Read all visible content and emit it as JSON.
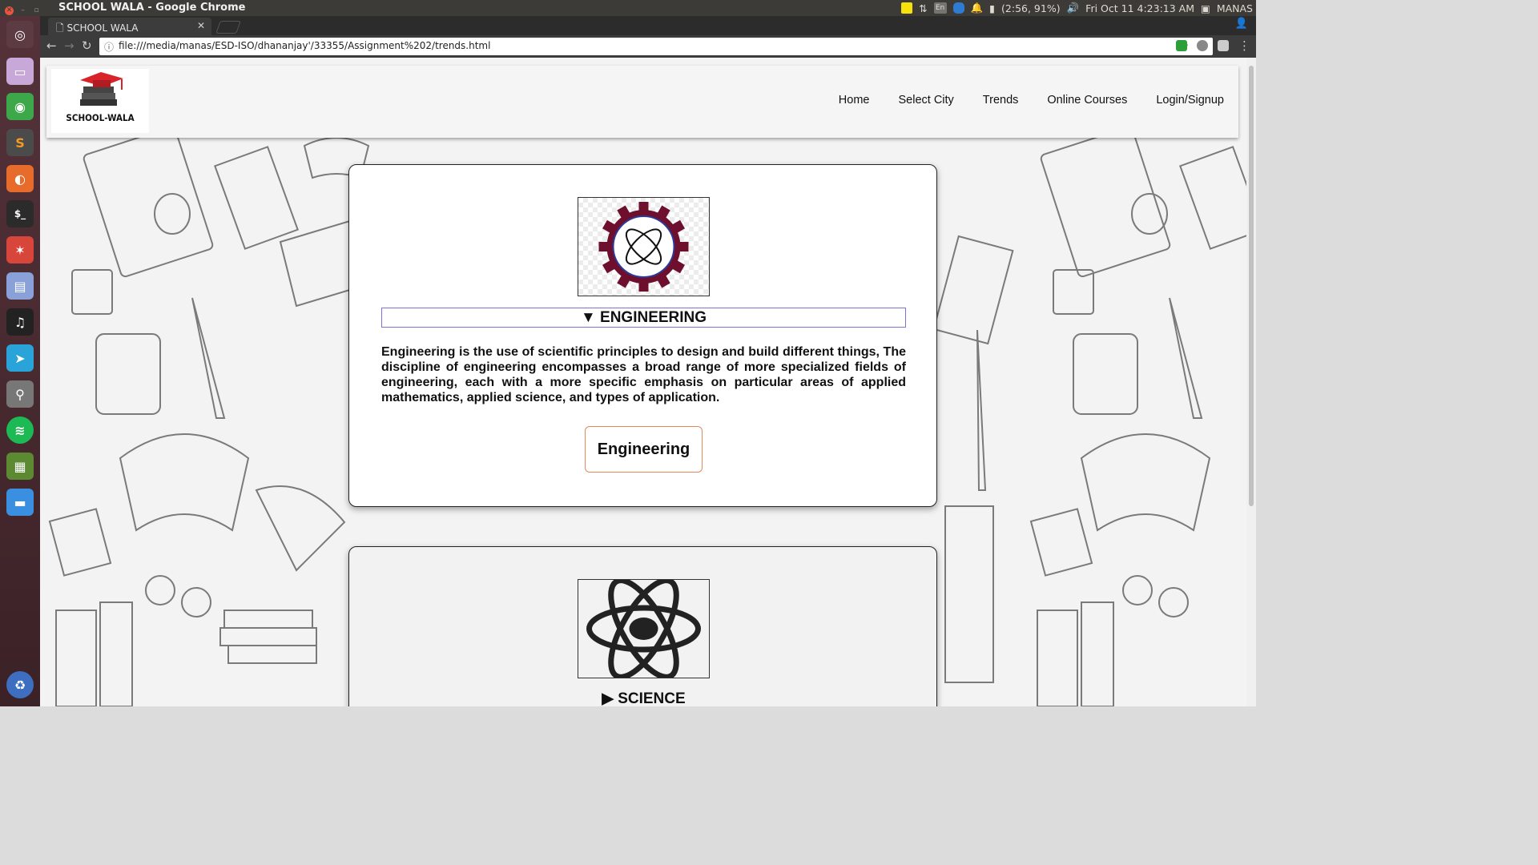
{
  "os": {
    "window_title": "SCHOOL WALA - Google Chrome",
    "battery": "(2:56, 91%)",
    "datetime": "Fri Oct 11  4:23:13 AM",
    "user": "MANAS",
    "lang": "En"
  },
  "browser": {
    "tab_title": "SCHOOL WALA",
    "url": "file:///media/manas/ESD-ISO/dhananjay'/33355/Assignment%202/trends.html"
  },
  "navbar": {
    "logo_text": "SCHOOL-WALA",
    "links": [
      "Home",
      "Select City",
      "Trends",
      "Online Courses",
      "Login/Signup"
    ]
  },
  "cards": [
    {
      "title": "▼ ENGINEERING",
      "description": "Engineering is the use of scientific principles to design and build different things, The discipline of engineering encompasses a broad range of more specialized fields of engineering, each with a more specific emphasis on particular areas of applied mathematics, applied science, and types of application.",
      "button": "Engineering",
      "icon": "engineering-gear-icon"
    },
    {
      "title": "▶ SCIENCE",
      "icon": "atom-icon"
    }
  ],
  "colors": {
    "gear": "#6e0f2e",
    "button_border": "#e0895a",
    "summary_border": "#7b73d8"
  }
}
